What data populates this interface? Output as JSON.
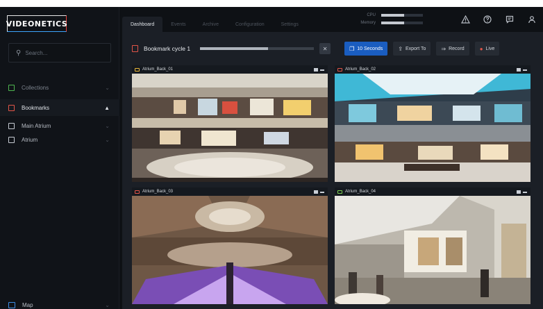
{
  "app": {
    "logo_text": "VIDEONETICS"
  },
  "sidebar": {
    "search_placeholder": "Search...",
    "search_icon": "magnifier-icon",
    "items": [
      {
        "label": "Collections",
        "icon": "monitor-icon",
        "color": "#4fb64f"
      },
      {
        "label": "Bookmarks",
        "icon": "bookmark-icon",
        "color": "#e25548",
        "active": true
      },
      {
        "label": "Main Atrium",
        "icon": "bookmark-icon",
        "color": "#c7ccd3"
      },
      {
        "label": "Atrium",
        "icon": "bookmark-icon",
        "color": "#c7ccd3"
      }
    ],
    "footer_item": {
      "label": "Map",
      "icon": "map-icon",
      "color": "#3d8ee6"
    }
  },
  "tabs": [
    "Dashboard",
    "Events",
    "Archive",
    "Configuration",
    "Settings"
  ],
  "active_tab": "Dashboard",
  "meters": [
    {
      "label": "CPU",
      "level": 0.55
    },
    {
      "label": "Memory",
      "level": 0.55
    }
  ],
  "top_icons": [
    "alert-triangle-icon",
    "help-circle-icon",
    "chat-icon",
    "user-icon"
  ],
  "toolbar": {
    "title": "Bookmark cycle 1",
    "cycle_progress": 0.6,
    "interval_label": "10 Seconds",
    "export_label": "Export To",
    "record_label": "Record",
    "live_label": "Live"
  },
  "cameras": [
    {
      "name": "Atrium_Back_01",
      "icon_color": "#e8b73a"
    },
    {
      "name": "Atrium_Back_02",
      "icon_color": "#e25548"
    },
    {
      "name": "Atrium_Back_03",
      "icon_color": "#e25548"
    },
    {
      "name": "Atrium_Back_04",
      "icon_color": "#7ccf53"
    }
  ]
}
